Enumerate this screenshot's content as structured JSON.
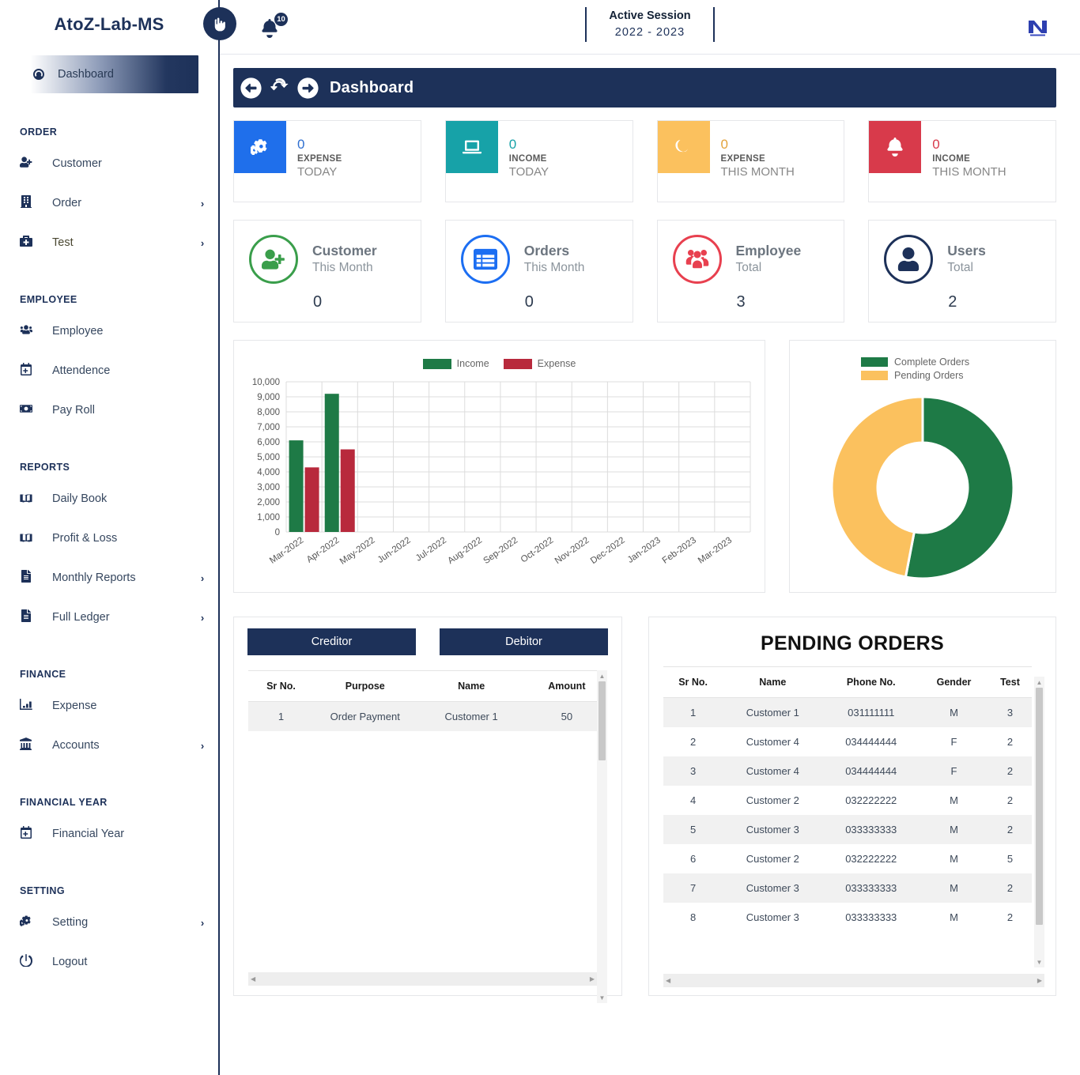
{
  "sidebar": {
    "brand": "AtoZ-Lab-MS",
    "active": {
      "label": "Dashboard",
      "icon": "dashboard-icon"
    },
    "sections": [
      {
        "title": "ORDER",
        "items": [
          {
            "label": "Customer",
            "icon": "user-plus-icon",
            "chevron": ""
          },
          {
            "label": "Order",
            "icon": "building-icon",
            "chevron": "›"
          },
          {
            "label": "Test",
            "icon": "briefcase-medical-icon",
            "chevron": "›"
          }
        ]
      },
      {
        "title": "EMPLOYEE",
        "items": [
          {
            "label": "Employee",
            "icon": "users-icon",
            "chevron": ""
          },
          {
            "label": "Attendence",
            "icon": "calendar-plus-icon",
            "chevron": ""
          },
          {
            "label": "Pay Roll",
            "icon": "money-bill-icon",
            "chevron": ""
          }
        ]
      },
      {
        "title": "REPORTS",
        "items": [
          {
            "label": "Daily Book",
            "icon": "book-open-icon",
            "chevron": ""
          },
          {
            "label": "Profit & Loss",
            "icon": "book-open-icon",
            "chevron": ""
          },
          {
            "label": "Monthly Reports",
            "icon": "file-lines-icon",
            "chevron": "›"
          },
          {
            "label": "Full Ledger",
            "icon": "file-lines-icon",
            "chevron": "›"
          }
        ]
      },
      {
        "title": "FINANCE",
        "items": [
          {
            "label": "Expense",
            "icon": "chart-bar-icon",
            "chevron": ""
          },
          {
            "label": "Accounts",
            "icon": "bank-icon",
            "chevron": "›"
          }
        ]
      },
      {
        "title": "FINANCIAL YEAR",
        "items": [
          {
            "label": "Financial Year",
            "icon": "calendar-plus-icon",
            "chevron": ""
          }
        ]
      },
      {
        "title": "SETTING",
        "items": [
          {
            "label": "Setting",
            "icon": "gears-icon",
            "chevron": "›"
          },
          {
            "label": "Logout",
            "icon": "power-off-icon",
            "chevron": ""
          }
        ]
      }
    ]
  },
  "topbar": {
    "toggle_icon": "hand-pointer-icon",
    "bell_icon": "bell-icon",
    "notification_count": "10",
    "session_title": "Active Session",
    "session_years": "2022  -  2023",
    "logo_letter": "N"
  },
  "pagehead": {
    "back_icon": "arrow-circle-left-icon",
    "refresh_icon": "refresh-icon",
    "forward_icon": "arrow-circle-right-icon",
    "title": "Dashboard"
  },
  "mini_cards": [
    {
      "icon": "gears-icon",
      "bg": "#1f6feb",
      "value": "0",
      "value_color": "#2f6fd0",
      "line1": "EXPENSE",
      "line2": "TODAY"
    },
    {
      "icon": "laptop-icon",
      "bg": "#17a2a8",
      "value": "0",
      "value_color": "#17a2a8",
      "line1": "INCOME",
      "line2": "TODAY"
    },
    {
      "icon": "moon-icon",
      "bg": "#fbc15e",
      "value": "0",
      "value_color": "#e3a33c",
      "line1": "EXPENSE",
      "line2": "THIS MONTH"
    },
    {
      "icon": "bell-icon",
      "bg": "#d83a4b",
      "value": "0",
      "value_color": "#d83a4b",
      "line1": "INCOME",
      "line2": "THIS MONTH"
    }
  ],
  "big_cards": [
    {
      "icon": "user-plus-icon",
      "color": "#3a9e4b",
      "title": "Customer",
      "sub": "This Month",
      "value": "0"
    },
    {
      "icon": "table-list-icon",
      "color": "#1c6ef2",
      "title": "Orders",
      "sub": "This Month",
      "value": "0"
    },
    {
      "icon": "user-group-icon",
      "color": "#e8404f",
      "title": "Employee",
      "sub": "Total",
      "value": "3"
    },
    {
      "icon": "user-icon",
      "color": "#1d3159",
      "title": "Users",
      "sub": "Total",
      "value": "2"
    }
  ],
  "chart_data": [
    {
      "type": "bar",
      "title": "",
      "xlabel": "",
      "ylabel": "",
      "ylim": [
        0,
        10000
      ],
      "yticks": [
        0,
        1000,
        2000,
        3000,
        4000,
        5000,
        6000,
        7000,
        8000,
        9000,
        10000
      ],
      "ytick_labels": [
        "0",
        "1,000",
        "2,000",
        "3,000",
        "4,000",
        "5,000",
        "6,000",
        "7,000",
        "8,000",
        "9,000",
        "10,000"
      ],
      "grid": true,
      "legend_position": "top-center",
      "categories": [
        "Mar-2022",
        "Apr-2022",
        "May-2022",
        "Jun-2022",
        "Jul-2022",
        "Aug-2022",
        "Sep-2022",
        "Oct-2022",
        "Nov-2022",
        "Dec-2022",
        "Jan-2023",
        "Feb-2023",
        "Mar-2023"
      ],
      "series": [
        {
          "name": "Income",
          "color": "#1e7a46",
          "values": [
            6100,
            9200,
            0,
            0,
            0,
            0,
            0,
            0,
            0,
            0,
            0,
            0,
            0
          ]
        },
        {
          "name": "Expense",
          "color": "#b8293c",
          "values": [
            4300,
            5500,
            0,
            0,
            0,
            0,
            0,
            0,
            0,
            0,
            0,
            0,
            0
          ]
        }
      ]
    },
    {
      "type": "pie",
      "variant": "donut",
      "title": "",
      "legend_position": "top-left",
      "labels": [
        "Complete Orders",
        "Pending Orders"
      ],
      "values": [
        53,
        47
      ],
      "colors": [
        "#1e7a46",
        "#fbc15e"
      ]
    }
  ],
  "creditor_panel": {
    "tabs": [
      {
        "label": "Creditor",
        "active": true
      },
      {
        "label": "Debitor",
        "active": false
      }
    ],
    "columns": [
      "Sr No.",
      "Purpose",
      "Name",
      "Amount"
    ],
    "rows": [
      [
        "1",
        "Order Payment",
        "Customer 1",
        "50"
      ]
    ]
  },
  "pending_orders": {
    "title": "PENDING ORDERS",
    "columns": [
      "Sr No.",
      "Name",
      "Phone No.",
      "Gender",
      "Test"
    ],
    "rows": [
      [
        "1",
        "Customer 1",
        "031111111",
        "M",
        "3"
      ],
      [
        "2",
        "Customer 4",
        "034444444",
        "F",
        "2"
      ],
      [
        "3",
        "Customer 4",
        "034444444",
        "F",
        "2"
      ],
      [
        "4",
        "Customer 2",
        "032222222",
        "M",
        "2"
      ],
      [
        "5",
        "Customer 3",
        "033333333",
        "M",
        "2"
      ],
      [
        "6",
        "Customer 2",
        "032222222",
        "M",
        "5"
      ],
      [
        "7",
        "Customer 3",
        "033333333",
        "M",
        "2"
      ],
      [
        "8",
        "Customer 3",
        "033333333",
        "M",
        "2"
      ]
    ]
  },
  "theme": {
    "navy": "#1d3159",
    "green": "#1e7a46",
    "red": "#b8293c",
    "yellow": "#fbc15e"
  }
}
